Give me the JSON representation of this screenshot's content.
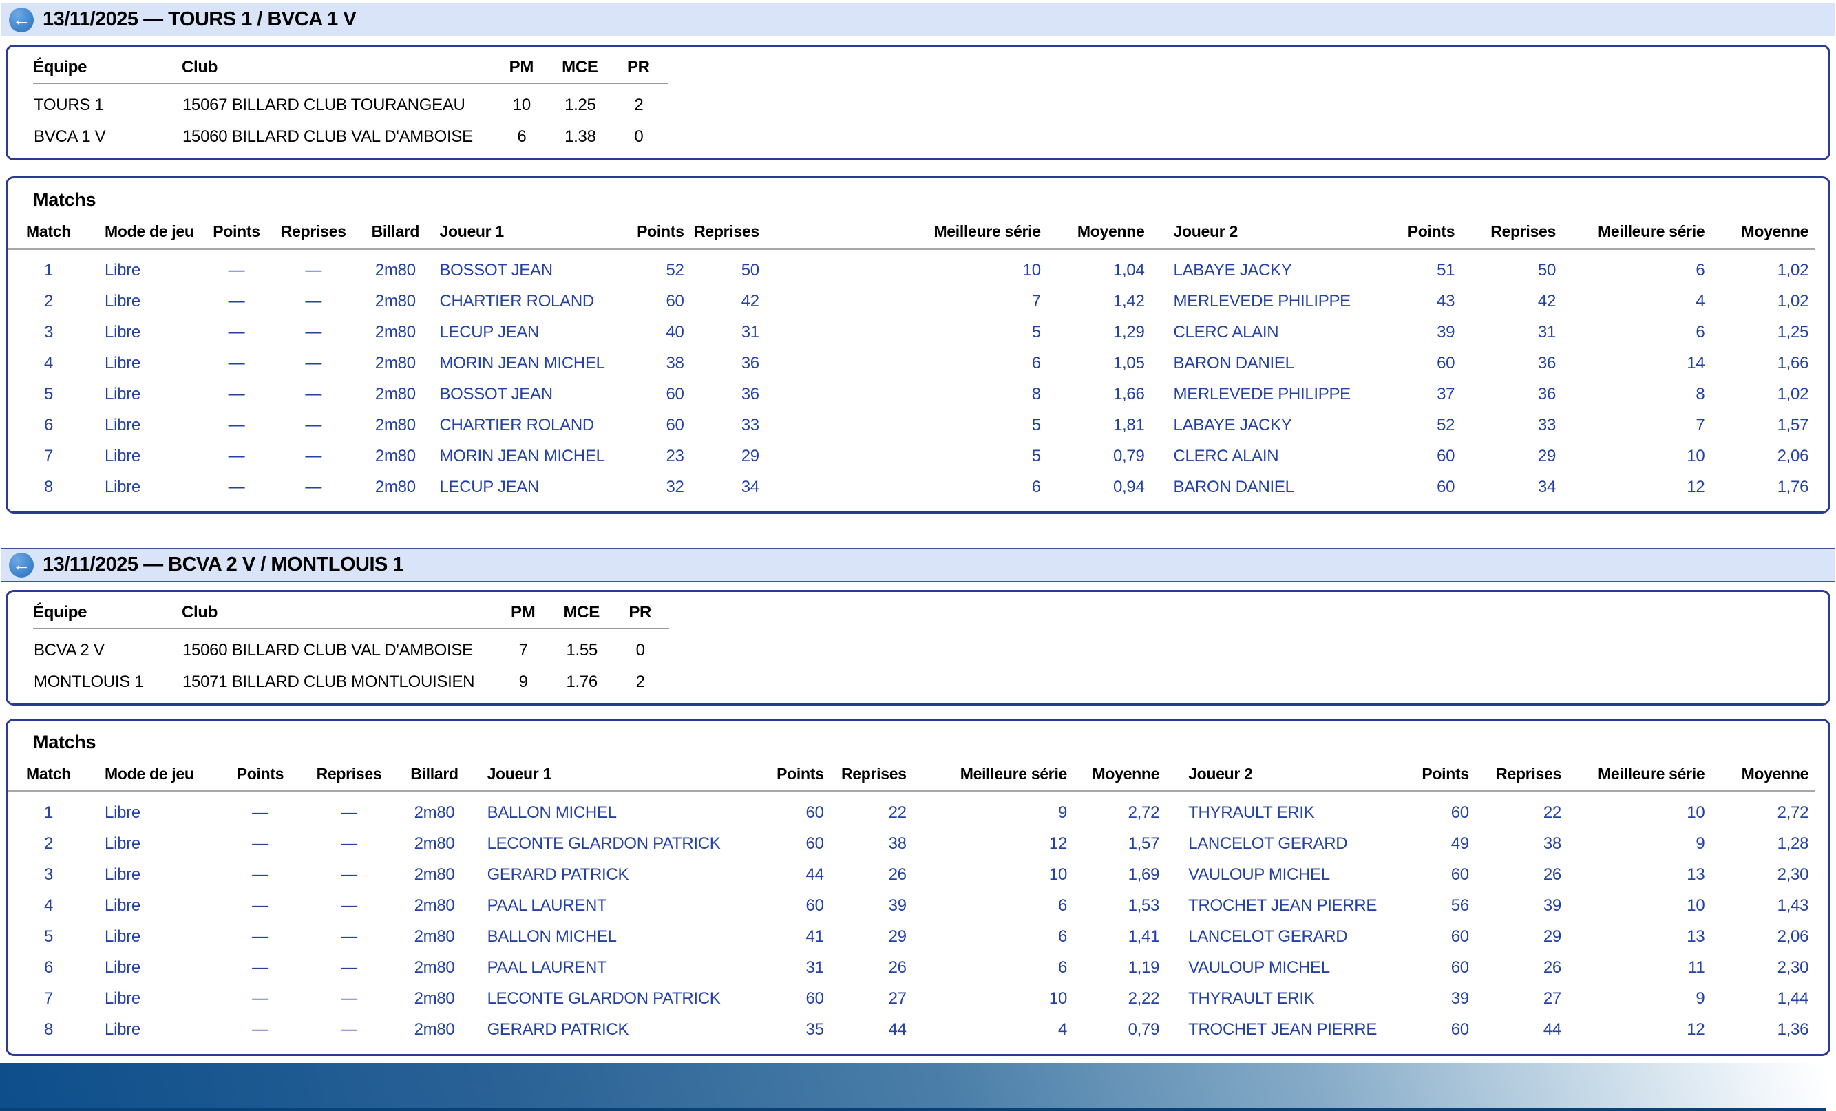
{
  "theme": {
    "header_bar_bg": "#d9e4f8",
    "box_border_blue": "#2b3b94",
    "data_text_blue": "#2442a5",
    "back_icon_blue": "#4489cf",
    "footer_gradient_dark": "#0d4e8b",
    "footer_gradient_light": "#ffffff"
  },
  "sections": [
    {
      "header": {
        "icon": "circle-arrow-left",
        "title": "13/11/2025 — TOURS 1 / BVCA 1 V"
      },
      "teams": {
        "columns": [
          "Équipe",
          "Club",
          "PM",
          "MCE",
          "PR"
        ],
        "rows": [
          [
            "TOURS 1",
            "15067 BILLARD CLUB TOURANGEAU",
            "10",
            "1.25",
            "2"
          ],
          [
            "BVCA 1 V",
            "15060 BILLARD CLUB VAL D'AMBOISE",
            "6",
            "1.38",
            "0"
          ]
        ]
      },
      "matchs": {
        "title": "Matchs",
        "columns": [
          "Match",
          "Mode de jeu",
          "Points",
          "Reprises",
          "Billard",
          "Joueur 1",
          "Points",
          "Reprises",
          "Meilleure série",
          "Moyenne",
          "Joueur 2",
          "Points",
          "Reprises",
          "Meilleure série",
          "Moyenne"
        ],
        "rows": [
          [
            "1",
            "Libre",
            "—",
            "—",
            "2m80",
            "BOSSOT JEAN",
            "52",
            "50",
            "10",
            "1,04",
            "LABAYE JACKY",
            "51",
            "50",
            "6",
            "1,02"
          ],
          [
            "2",
            "Libre",
            "—",
            "—",
            "2m80",
            "CHARTIER ROLAND",
            "60",
            "42",
            "7",
            "1,42",
            "MERLEVEDE PHILIPPE",
            "43",
            "42",
            "4",
            "1,02"
          ],
          [
            "3",
            "Libre",
            "—",
            "—",
            "2m80",
            "LECUP JEAN",
            "40",
            "31",
            "5",
            "1,29",
            "CLERC ALAIN",
            "39",
            "31",
            "6",
            "1,25"
          ],
          [
            "4",
            "Libre",
            "—",
            "—",
            "2m80",
            "MORIN JEAN MICHEL",
            "38",
            "36",
            "6",
            "1,05",
            "BARON DANIEL",
            "60",
            "36",
            "14",
            "1,66"
          ],
          [
            "5",
            "Libre",
            "—",
            "—",
            "2m80",
            "BOSSOT JEAN",
            "60",
            "36",
            "8",
            "1,66",
            "MERLEVEDE PHILIPPE",
            "37",
            "36",
            "8",
            "1,02"
          ],
          [
            "6",
            "Libre",
            "—",
            "—",
            "2m80",
            "CHARTIER ROLAND",
            "60",
            "33",
            "5",
            "1,81",
            "LABAYE JACKY",
            "52",
            "33",
            "7",
            "1,57"
          ],
          [
            "7",
            "Libre",
            "—",
            "—",
            "2m80",
            "MORIN JEAN MICHEL",
            "23",
            "29",
            "5",
            "0,79",
            "CLERC ALAIN",
            "60",
            "29",
            "10",
            "2,06"
          ],
          [
            "8",
            "Libre",
            "—",
            "—",
            "2m80",
            "LECUP JEAN",
            "32",
            "34",
            "6",
            "0,94",
            "BARON DANIEL",
            "60",
            "34",
            "12",
            "1,76"
          ]
        ]
      }
    },
    {
      "header": {
        "icon": "circle-arrow-left",
        "title": "13/11/2025 — BCVA 2 V / MONTLOUIS 1"
      },
      "teams": {
        "columns": [
          "Équipe",
          "Club",
          "PM",
          "MCE",
          "PR"
        ],
        "rows": [
          [
            "BCVA 2 V",
            "15060 BILLARD CLUB VAL D'AMBOISE",
            "7",
            "1.55",
            "0"
          ],
          [
            "MONTLOUIS 1",
            "15071 BILLARD CLUB MONTLOUISIEN",
            "9",
            "1.76",
            "2"
          ]
        ]
      },
      "matchs": {
        "title": "Matchs",
        "columns": [
          "Match",
          "Mode de jeu",
          "Points",
          "Reprises",
          "Billard",
          "Joueur 1",
          "Points",
          "Reprises",
          "Meilleure série",
          "Moyenne",
          "Joueur 2",
          "Points",
          "Reprises",
          "Meilleure série",
          "Moyenne"
        ],
        "rows": [
          [
            "1",
            "Libre",
            "—",
            "—",
            "2m80",
            "BALLON MICHEL",
            "60",
            "22",
            "9",
            "2,72",
            "THYRAULT ERIK",
            "60",
            "22",
            "10",
            "2,72"
          ],
          [
            "2",
            "Libre",
            "—",
            "—",
            "2m80",
            "LECONTE GLARDON PATRICK",
            "60",
            "38",
            "12",
            "1,57",
            "LANCELOT GERARD",
            "49",
            "38",
            "9",
            "1,28"
          ],
          [
            "3",
            "Libre",
            "—",
            "—",
            "2m80",
            "GERARD PATRICK",
            "44",
            "26",
            "10",
            "1,69",
            "VAULOUP MICHEL",
            "60",
            "26",
            "13",
            "2,30"
          ],
          [
            "4",
            "Libre",
            "—",
            "—",
            "2m80",
            "PAAL LAURENT",
            "60",
            "39",
            "6",
            "1,53",
            "TROCHET JEAN PIERRE",
            "56",
            "39",
            "10",
            "1,43"
          ],
          [
            "5",
            "Libre",
            "—",
            "—",
            "2m80",
            "BALLON MICHEL",
            "41",
            "29",
            "6",
            "1,41",
            "LANCELOT GERARD",
            "60",
            "29",
            "13",
            "2,06"
          ],
          [
            "6",
            "Libre",
            "—",
            "—",
            "2m80",
            "PAAL LAURENT",
            "31",
            "26",
            "6",
            "1,19",
            "VAULOUP MICHEL",
            "60",
            "26",
            "11",
            "2,30"
          ],
          [
            "7",
            "Libre",
            "—",
            "—",
            "2m80",
            "LECONTE GLARDON PATRICK",
            "60",
            "27",
            "10",
            "2,22",
            "THYRAULT ERIK",
            "39",
            "27",
            "9",
            "1,44"
          ],
          [
            "8",
            "Libre",
            "—",
            "—",
            "2m80",
            "GERARD PATRICK",
            "35",
            "44",
            "4",
            "0,79",
            "TROCHET JEAN PIERRE",
            "60",
            "44",
            "12",
            "1,36"
          ]
        ]
      }
    }
  ]
}
